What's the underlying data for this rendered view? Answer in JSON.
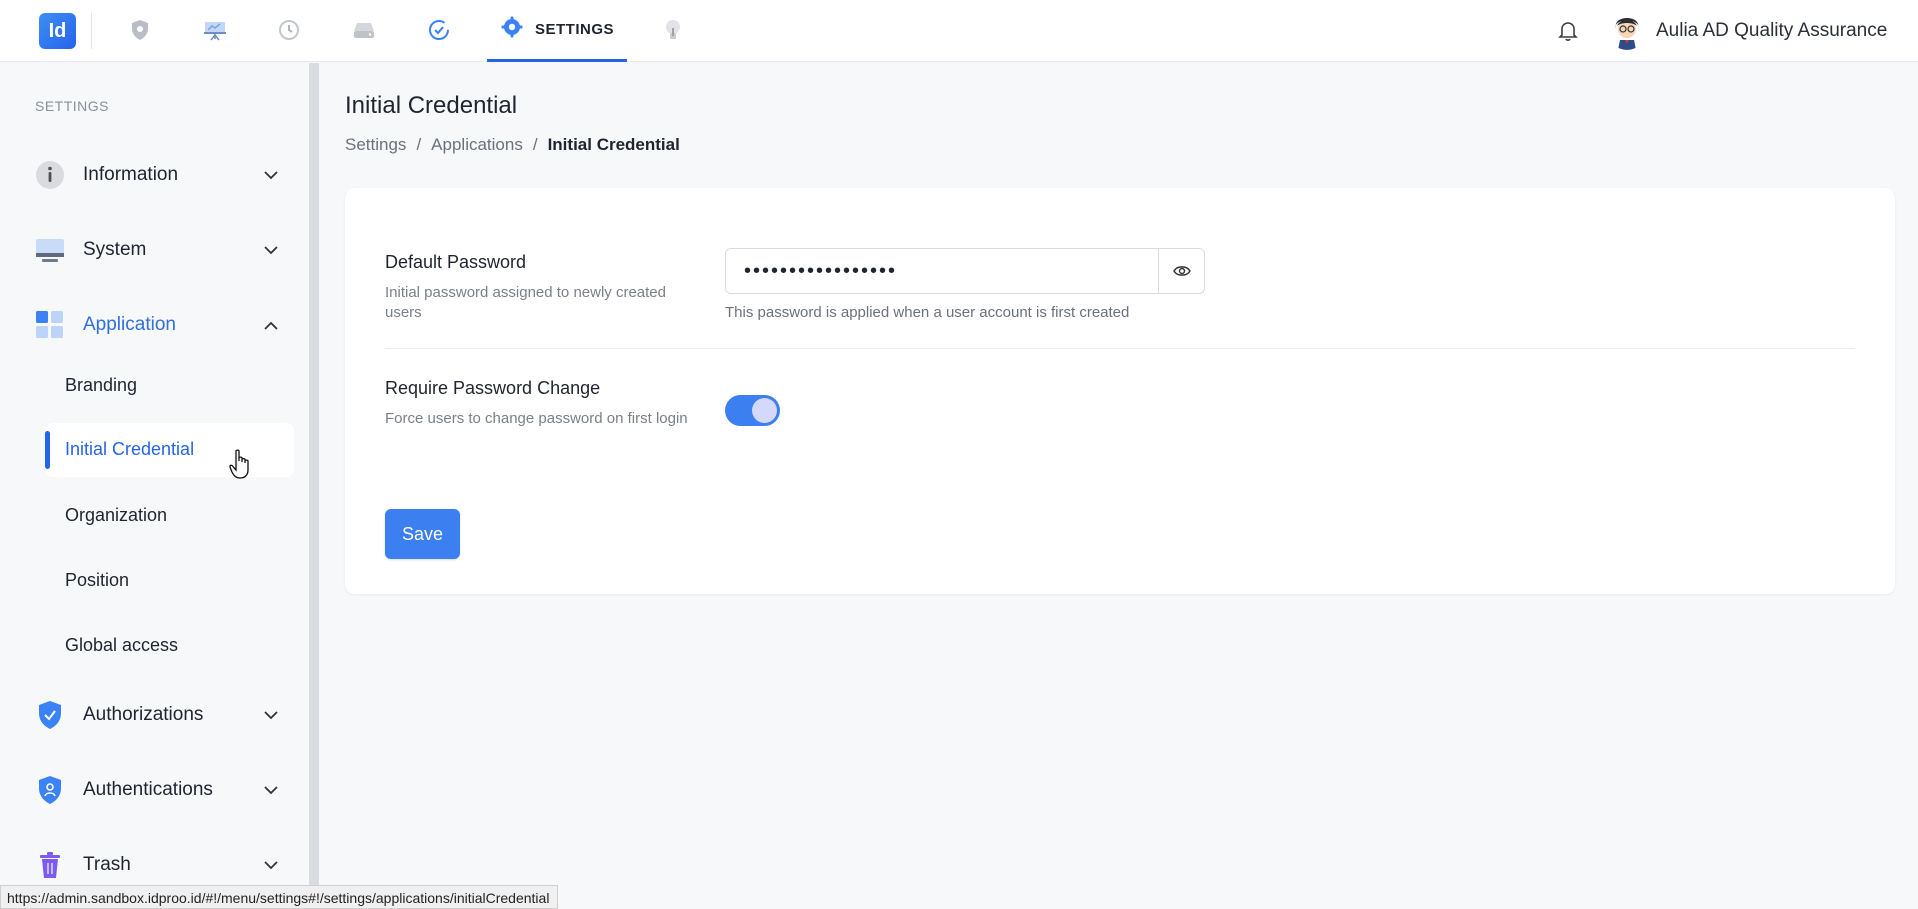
{
  "app": {
    "logo_text": "Id",
    "nav_icons": [
      "shield-icon",
      "presentation-icon",
      "history-icon",
      "drive-icon",
      "check-circle-icon",
      "gear-icon",
      "lightbulb-icon"
    ],
    "active_tab": "SETTINGS",
    "user_name": "Aulia AD Quality Assurance",
    "accent_color": "#2563eb"
  },
  "sidebar": {
    "heading": "SETTINGS",
    "groups": [
      {
        "label": "Information",
        "icon": "info-icon"
      },
      {
        "label": "System",
        "icon": "monitor-icon"
      },
      {
        "label": "Application",
        "icon": "grid-icon",
        "expanded": true
      },
      {
        "label": "Authorizations",
        "icon": "shield-check-icon"
      },
      {
        "label": "Authentications",
        "icon": "shield-user-icon"
      },
      {
        "label": "Trash",
        "icon": "trash-icon"
      }
    ],
    "sub_items": [
      "Branding",
      "Initial Credential",
      "Organization",
      "Position",
      "Global access"
    ],
    "active_sub_item": "Initial Credential"
  },
  "main": {
    "title": "Initial Credential",
    "breadcrumb": [
      "Settings",
      "/",
      "Applications",
      "/",
      "Initial Credential"
    ],
    "default_password": {
      "label": "Default Password",
      "description": "Initial password assigned to newly created users",
      "value": "•••••••••••••••••",
      "help": "This password is applied when a user account is first created"
    },
    "require_change": {
      "label": "Require Password Change",
      "description": "Force users to change password on first login",
      "enabled": true
    },
    "save_label": "Save"
  },
  "status_url": "https://admin.sandbox.idproo.id/#!/menu/settings#!/settings/applications/initialCredential"
}
